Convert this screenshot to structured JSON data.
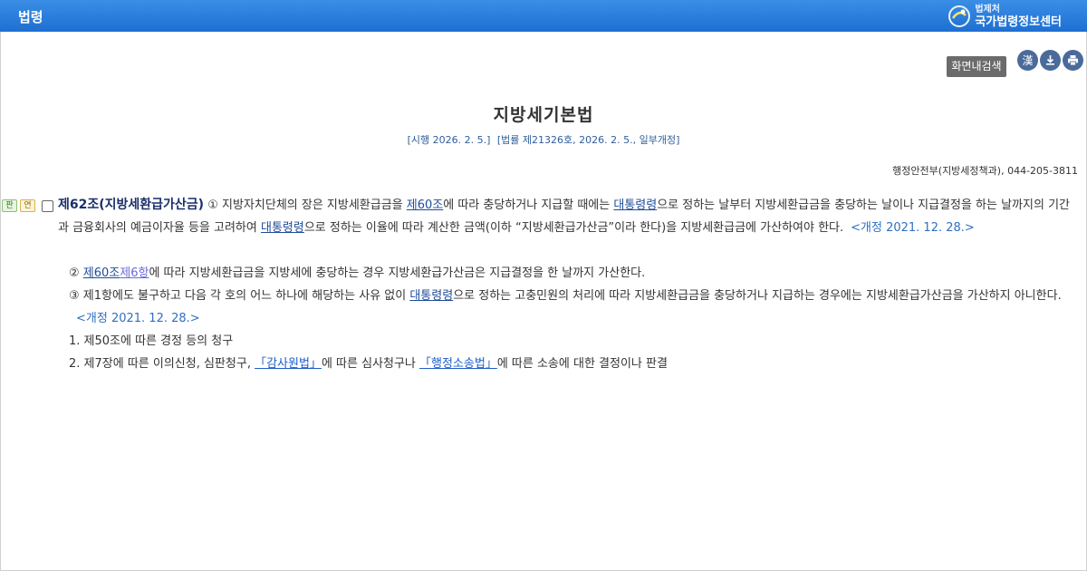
{
  "topbar": {
    "title": "법령",
    "brand_small": "법제처",
    "brand_big": "국가법령정보센터"
  },
  "toolbar": {
    "search_label": "화면내검색",
    "hanja_label": "漢"
  },
  "law": {
    "title": "지방세기본법",
    "enforcement": "[시행 2026. 2. 5.]",
    "promulgation": "[법률 제21326호, 2026. 2. 5., 일부개정]",
    "ministry": "행정안전부(지방세정책과), 044-205-3811"
  },
  "article": {
    "tag_pan": "판",
    "tag_yeon": "연",
    "heading": "제62조(지방세환급가산금)",
    "p1_a": " ① 지방자치단체의 장은 지방세환급금을 ",
    "p1_link1": "제60조",
    "p1_b": "에 따라 충당하거나 지급할 때에는 ",
    "p1_link2": "대통령령",
    "p1_c": "으로 정하는 날부터 지방세환급금을 충당하는 날이나 지급결정을 하는 날까지의 기간과 금융회사의 예금이자율 등을 고려하여 ",
    "p1_link3": "대통령령",
    "p1_d": "으로 정하는 이율에 따라 계산한 금액(이하 “지방세환급가산금”이라 한다)을 지방세환급금에 가산하여야 한다.",
    "p1_rev": "<개정 2021. 12. 28.>",
    "p2_a": "② ",
    "p2_link1": "제60조",
    "p2_link2": "제6항",
    "p2_b": "에 따라 지방세환급금을 지방세에 충당하는 경우 지방세환급가산금은 지급결정을 한 날까지 가산한다.",
    "p3_a": "③ 제1항에도 불구하고 다음 각 호의 어느 하나에 해당하는 사유 없이 ",
    "p3_link": "대통령령",
    "p3_b": "으로 정하는 고충민원의 처리에 따라 지방세환급금을 충당하거나 지급하는 경우에는 지방세환급가산금을 가산하지 아니한다.",
    "p3_rev": "<개정 2021. 12. 28.>",
    "item1": "1. 제50조에 따른 경정 등의 청구",
    "item2_a": "2. 제7장에 따른 이의신청, 심판청구, ",
    "item2_link1": "「감사원법」",
    "item2_b": "에 따른 심사청구나 ",
    "item2_link2": "「행정소송법」",
    "item2_c": "에 따른 소송에 대한 결정이나 판결"
  },
  "colors": {
    "topbar": "#2a7fdc",
    "heading": "#1b2f6b",
    "link": "#1f4c9a",
    "revision": "#2f6fc2"
  },
  "icons": [
    "download-icon",
    "print-icon",
    "brand-logo-icon"
  ]
}
